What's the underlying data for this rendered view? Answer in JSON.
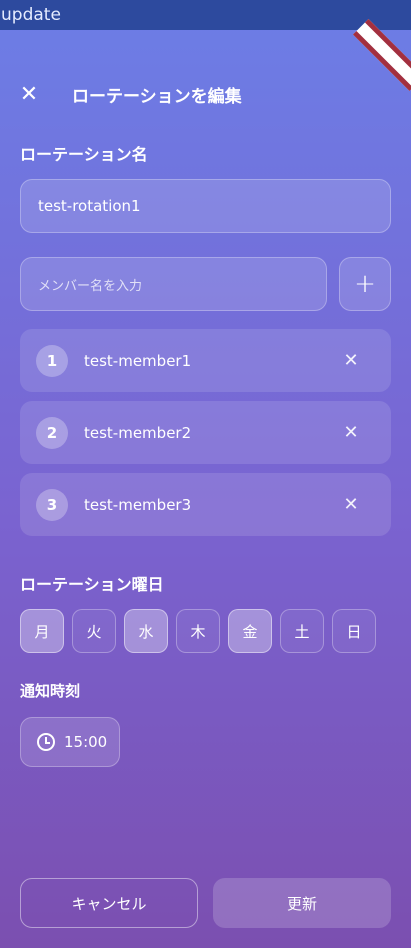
{
  "topbar": {
    "text": "update"
  },
  "header": {
    "title": "ローテーションを編集",
    "close_icon": "close-icon"
  },
  "rotation_name": {
    "label": "ローテーション名",
    "value": "test-rotation1"
  },
  "member_input": {
    "placeholder": "メンバー名を入力",
    "add_label": "+"
  },
  "members": [
    {
      "number": "1",
      "name": "test-member1",
      "remove": "✕"
    },
    {
      "number": "2",
      "name": "test-member2",
      "remove": "✕"
    },
    {
      "number": "3",
      "name": "test-member3",
      "remove": "✕"
    }
  ],
  "days": {
    "label": "ローテーション曜日",
    "items": [
      {
        "label": "月",
        "selected": true
      },
      {
        "label": "火",
        "selected": false
      },
      {
        "label": "水",
        "selected": true
      },
      {
        "label": "木",
        "selected": false
      },
      {
        "label": "金",
        "selected": true
      },
      {
        "label": "土",
        "selected": false
      },
      {
        "label": "日",
        "selected": false
      }
    ]
  },
  "notify": {
    "label": "通知時刻",
    "time": "15:00",
    "icon": "clock-icon"
  },
  "actions": {
    "cancel": "キャンセル",
    "update": "更新"
  },
  "colors": {
    "topbar": "#2d4a9e",
    "bg_top": "#6c7ee6",
    "bg_bottom": "#7b4fb0",
    "ribbon_stripe": "#a3303f"
  }
}
